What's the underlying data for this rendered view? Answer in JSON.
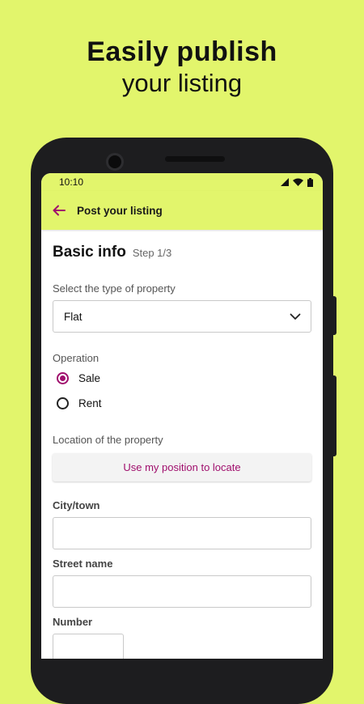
{
  "headline": {
    "line1": "Easily publish",
    "line2": "your listing"
  },
  "status_bar": {
    "time": "10:10",
    "icons": [
      "signal-icon",
      "wifi-icon",
      "battery-icon"
    ]
  },
  "app_bar": {
    "back_icon": "arrow-left-icon",
    "title": "Post your listing"
  },
  "form": {
    "section_title": "Basic info",
    "step": "Step 1/3",
    "property_type": {
      "label": "Select the type of property",
      "value": "Flat"
    },
    "operation": {
      "label": "Operation",
      "options": [
        {
          "label": "Sale",
          "selected": true
        },
        {
          "label": "Rent",
          "selected": false
        }
      ]
    },
    "location": {
      "label": "Location of the property",
      "button": "Use my position to locate"
    },
    "city": {
      "label": "City/town",
      "value": ""
    },
    "street": {
      "label": "Street name",
      "value": ""
    },
    "number": {
      "label": "Number",
      "value": ""
    }
  },
  "colors": {
    "background": "#e2f56c",
    "accent": "#a00f6d",
    "phone": "#1d1d1f"
  }
}
